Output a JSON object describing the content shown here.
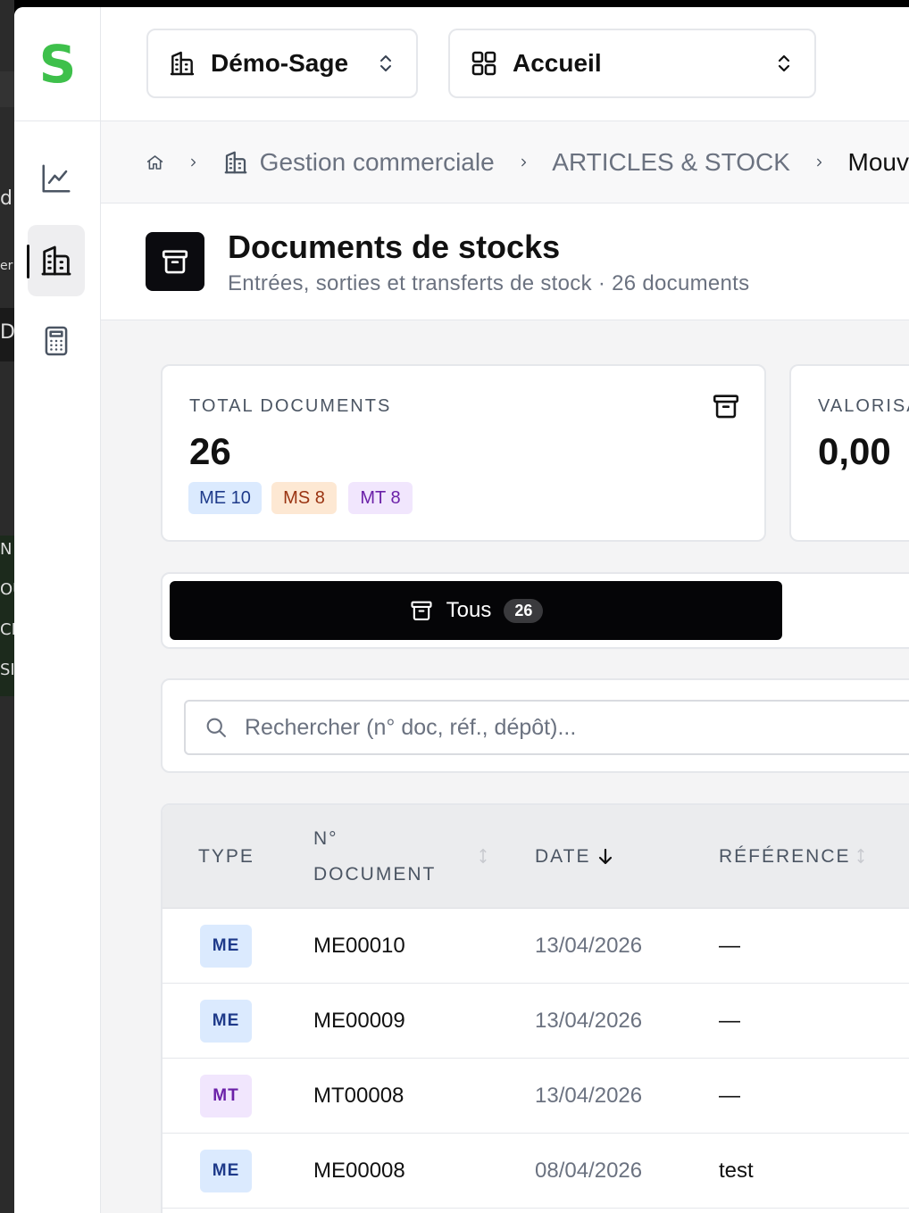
{
  "company_select": {
    "label": "Démo-Sage"
  },
  "module_select": {
    "label": "Accueil"
  },
  "breadcrumb": {
    "items": [
      "Gestion commerciale",
      "ARTICLES & STOCK",
      "Mouv"
    ]
  },
  "page": {
    "title": "Documents de stocks",
    "subtitle": "Entrées, sorties et transferts de stock · 26 documents"
  },
  "kpis": {
    "total": {
      "label": "TOTAL DOCUMENTS",
      "value": "26",
      "pills": [
        "ME 10",
        "MS 8",
        "MT 8"
      ]
    },
    "valorisation": {
      "label": "VALORISA",
      "value": "0,00"
    }
  },
  "filter": {
    "label": "Tous",
    "count": "26"
  },
  "search": {
    "placeholder": "Rechercher (n° doc, réf., dépôt)..."
  },
  "table": {
    "headers": {
      "type": "TYPE",
      "numero_line1": "N°",
      "numero_line2": "DOCUMENT",
      "date": "DATE",
      "reference": "RÉFÉRENCE"
    },
    "rows": [
      {
        "type": "ME",
        "numero": "ME00010",
        "date": "13/04/2026",
        "reference": "—"
      },
      {
        "type": "ME",
        "numero": "ME00009",
        "date": "13/04/2026",
        "reference": "—"
      },
      {
        "type": "MT",
        "numero": "MT00008",
        "date": "13/04/2026",
        "reference": "—"
      },
      {
        "type": "ME",
        "numero": "ME00008",
        "date": "08/04/2026",
        "reference": "test"
      }
    ]
  },
  "colors": {
    "brand": "#3ec04b",
    "me_bg": "#dbeafe",
    "me_fg": "#1e3a8a",
    "ms_bg": "#fde8d3",
    "ms_fg": "#9a3412",
    "mt_bg": "#f1e6fd",
    "mt_fg": "#6b21a8"
  },
  "icons": {
    "logo": "S",
    "rail": [
      "chart-line-icon",
      "building-icon",
      "calculator-icon"
    ],
    "breadcrumb": [
      "home-icon",
      "building-icon"
    ],
    "page": "archive-box-icon"
  }
}
